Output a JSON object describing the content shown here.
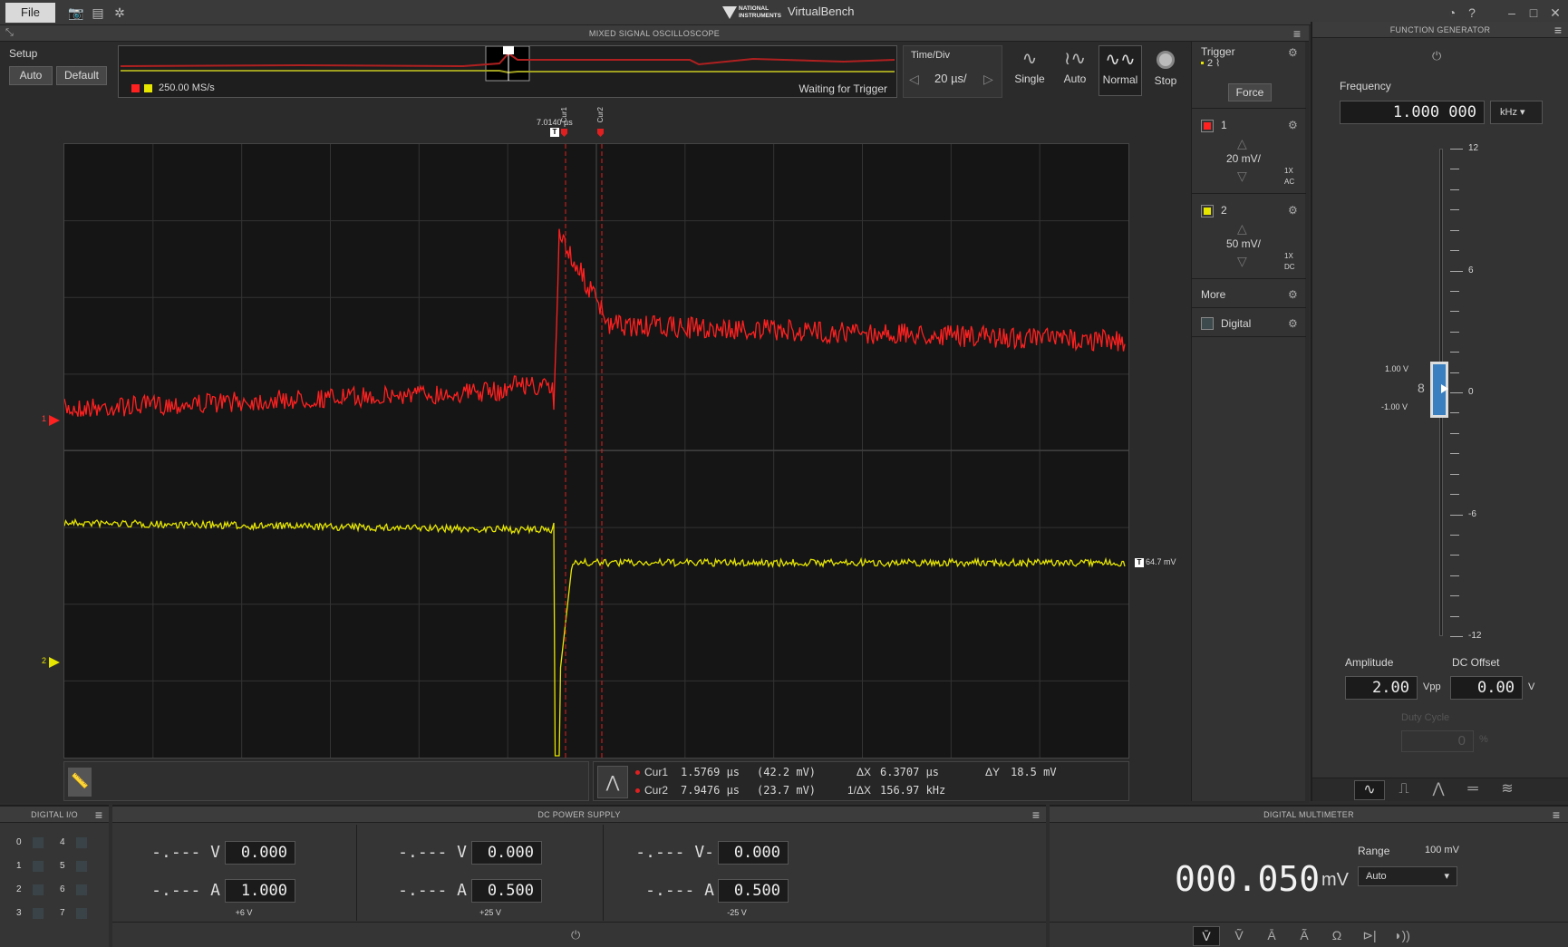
{
  "window": {
    "title": "VirtualBench",
    "file_label": "File",
    "brand": "NATIONAL INSTRUMENTS"
  },
  "scope": {
    "panel_title": "MIXED SIGNAL OSCILLOSCOPE",
    "setup_label": "Setup",
    "auto_btn": "Auto",
    "default_btn": "Default",
    "sample_rate": "250.00 MS/s",
    "status": "Waiting for Trigger",
    "timediv_label": "Time/Div",
    "timediv_value": "20 µs/",
    "modes": [
      "Single",
      "Auto",
      "Normal",
      "Stop"
    ],
    "trigger_time": "7.0140 µs",
    "cur1_tag": "Cur1",
    "cur2_tag": "Cur2",
    "trigger_level": "64.7 mV",
    "ch1_marker": "1",
    "ch2_marker": "2",
    "readout": {
      "cur1_label": "Cur1",
      "cur1_time": "1.5769 µs",
      "cur1_val": "(42.2 mV)",
      "cur2_label": "Cur2",
      "cur2_time": "7.9476 µs",
      "cur2_val": "(23.7 mV)",
      "dx_label": "ΔX",
      "dx": "6.3707 µs",
      "inv_dx_label": "1/ΔX",
      "inv_dx": "156.97 kHz",
      "dy_label": "ΔY",
      "dy": "18.5 mV"
    },
    "colors": {
      "ch1": "#ff2020",
      "ch2": "#e6e600"
    }
  },
  "channels": {
    "trigger_label": "Trigger",
    "trigger_src": "2",
    "force_btn": "Force",
    "ch1": {
      "label": "1",
      "scale": "20 mV/",
      "probe": "1X",
      "coupling": "AC"
    },
    "ch2": {
      "label": "2",
      "scale": "50 mV/",
      "probe": "1X",
      "coupling": "DC"
    },
    "more_label": "More",
    "digital_label": "Digital"
  },
  "fgen": {
    "panel_title": "FUNCTION GENERATOR",
    "frequency_label": "Frequency",
    "frequency": "1.000 000",
    "freq_unit": "kHz",
    "scale_ticks": [
      "12",
      "6",
      "0",
      "-6",
      "-12"
    ],
    "upper": "1.00 V",
    "lower": "-1.00 V",
    "amplitude_label": "Amplitude",
    "amplitude": "2.00",
    "amp_unit": "Vpp",
    "offset_label": "DC Offset",
    "offset": "0.00",
    "offset_unit": "V",
    "duty_label": "Duty Cycle",
    "duty": "0",
    "duty_unit": "%"
  },
  "dio": {
    "panel_title": "DIGITAL I/O",
    "pins": [
      "0",
      "4",
      "1",
      "5",
      "2",
      "6",
      "3",
      "7"
    ]
  },
  "psu": {
    "panel_title": "DC POWER SUPPLY",
    "channels": [
      {
        "v_read": "-.--- V",
        "v_set": "0.000",
        "a_read": "-.--- A",
        "a_set": "1.000",
        "name": "+6 V"
      },
      {
        "v_read": "-.--- V",
        "v_set": "0.000",
        "a_read": "-.--- A",
        "a_set": "0.500",
        "name": "+25 V"
      },
      {
        "v_read": "-.--- V-",
        "v_set": "0.000",
        "a_read": "-.--- A",
        "a_set": "0.500",
        "name": "-25 V"
      }
    ]
  },
  "dmm": {
    "panel_title": "DIGITAL MULTIMETER",
    "reading": "000.050",
    "unit": "mV",
    "range_label": "Range",
    "range_value": "100 mV",
    "range_select": "Auto"
  }
}
